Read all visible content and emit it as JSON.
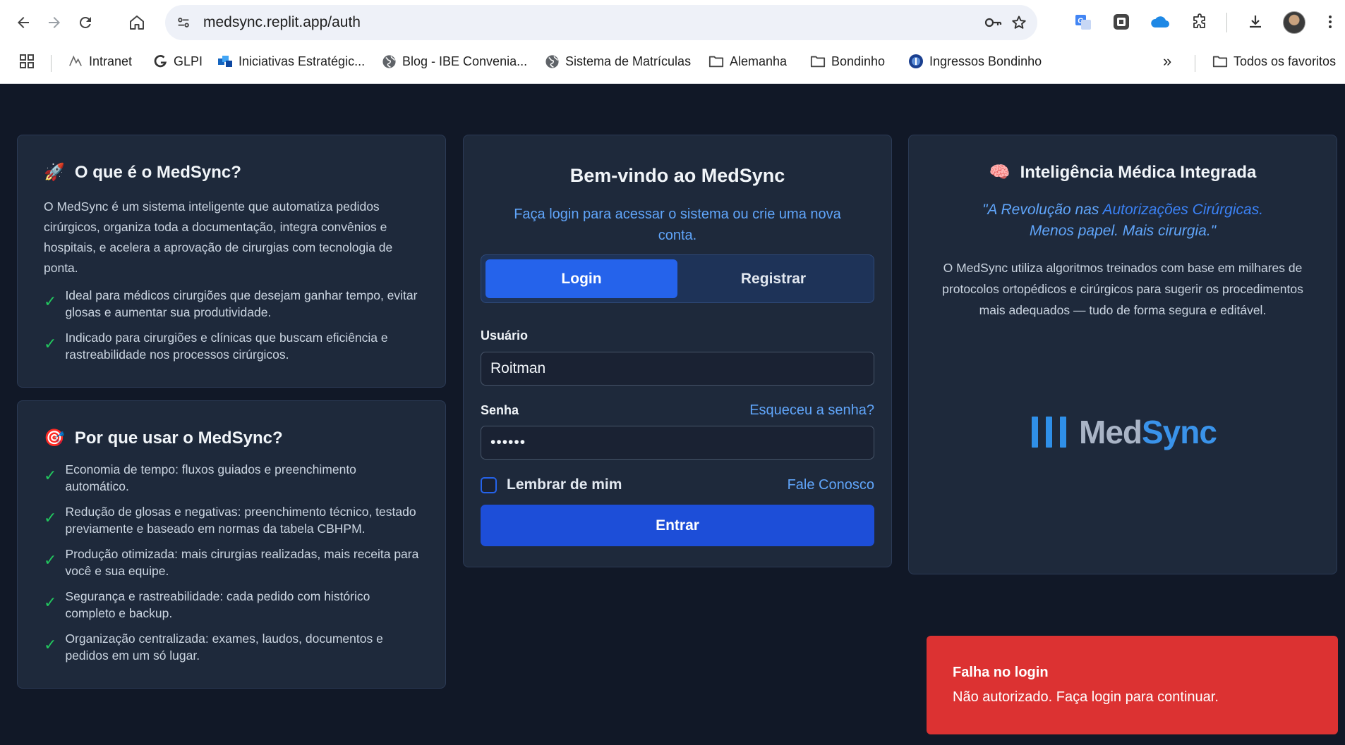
{
  "browser": {
    "url": "medsync.replit.app/auth",
    "bookmarks": [
      {
        "label": "Intranet",
        "icon": "intranet-icon"
      },
      {
        "label": "GLPI",
        "icon": "glpi-icon"
      },
      {
        "label": "Iniciativas Estratégic...",
        "icon": "app-icon"
      },
      {
        "label": "Blog - IBE Convenia...",
        "icon": "globe-icon"
      },
      {
        "label": "Sistema de Matrículas",
        "icon": "globe-icon"
      },
      {
        "label": "Alemanha",
        "icon": "folder-icon"
      },
      {
        "label": "Bondinho",
        "icon": "folder-icon"
      },
      {
        "label": "Ingressos Bondinho",
        "icon": "site-icon"
      }
    ],
    "more": "»",
    "all_bookmarks": "Todos os favoritos"
  },
  "what": {
    "emoji": "🚀",
    "title": "O que é o MedSync?",
    "desc": "O MedSync é um sistema inteligente que automatiza pedidos cirúrgicos, organiza toda a documentação, integra convênios e hospitais, e acelera a aprovação de cirurgias com tecnologia de ponta.",
    "items": [
      "Ideal para médicos cirurgiões que desejam ganhar tempo, evitar glosas e aumentar sua produtividade.",
      "Indicado para cirurgiões e clínicas que buscam eficiência e rastreabilidade nos processos cirúrgicos."
    ]
  },
  "why": {
    "emoji": "🎯",
    "title": "Por que usar o MedSync?",
    "items": [
      "Economia de tempo: fluxos guiados e preenchimento automático.",
      "Redução de glosas e negativas: preenchimento técnico, testado previamente e baseado em normas da tabela CBHPM.",
      "Produção otimizada: mais cirurgias realizadas, mais receita para você e sua equipe.",
      "Segurança e rastreabilidade: cada pedido com histórico completo e backup.",
      "Organização centralizada: exames, laudos, documentos e pedidos em um só lugar."
    ]
  },
  "login": {
    "title": "Bem-vindo ao MedSync",
    "subtitle": "Faça login para acessar o sistema ou crie uma nova conta.",
    "tabs": {
      "login": "Login",
      "register": "Registrar"
    },
    "username_label": "Usuário",
    "username_value": "Roitman",
    "password_label": "Senha",
    "forgot": "Esqueceu a senha?",
    "password_value": "••••••",
    "remember": "Lembrar de mim",
    "contact": "Fale Conosco",
    "submit": "Entrar"
  },
  "ai": {
    "emoji": "🧠",
    "title": "Inteligência Médica Integrada",
    "quote_part1": "\"A Revolução nas ",
    "quote_highlight": "Autorizações Cirúrgicas.",
    "quote_part2": "Menos papel. Mais cirurgia.\"",
    "desc": "O MedSync utiliza algoritmos treinados com base em milhares de protocolos ortopédicos e cirúrgicos para sugerir os procedimentos mais adequados — tudo de forma segura e editável.",
    "logo_med": "Med",
    "logo_sync": "Sync"
  },
  "toast": {
    "title": "Falha no login",
    "message": "Não autorizado. Faça login para continuar."
  },
  "colors": {
    "background": "#111827",
    "card": "#1e293b",
    "primary": "#2563eb",
    "link": "#60a5fa",
    "check": "#22c55e",
    "toast": "#dc3232"
  }
}
